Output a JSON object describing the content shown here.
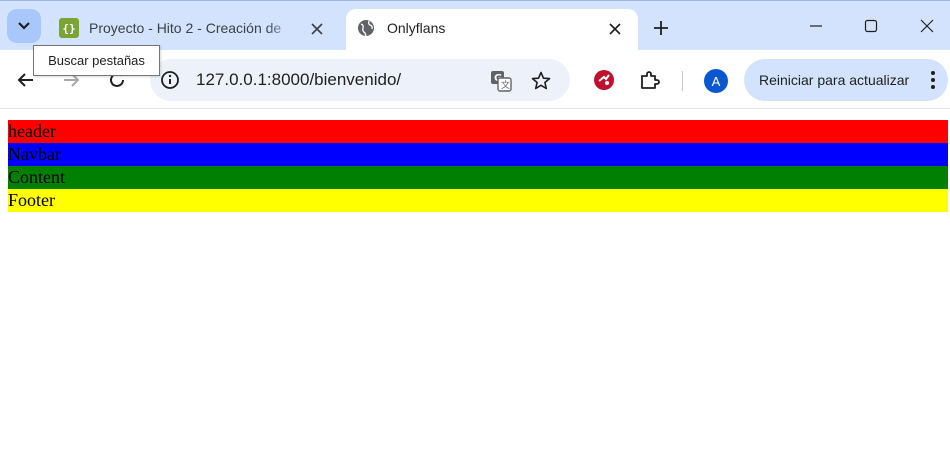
{
  "tabs": [
    {
      "title": "Proyecto - Hito 2 - Creación de",
      "active": false,
      "favicon": "pycharm-icon"
    },
    {
      "title": "Onlyflans",
      "active": true,
      "favicon": "globe-icon"
    }
  ],
  "tooltip": {
    "text": "Buscar pestañas"
  },
  "address_bar": {
    "url": "127.0.0.1:8000/bienvenido/"
  },
  "profile": {
    "initial": "A"
  },
  "update_button": {
    "label": "Reiniciar para actualizar"
  },
  "page": {
    "header": {
      "text": "header",
      "color": "#ff0000"
    },
    "navbar": {
      "text": "Navbar",
      "color": "#0000ff"
    },
    "content": {
      "text": "Content",
      "color": "#008000"
    },
    "footer": {
      "text": "Footer",
      "color": "#ffff00"
    }
  }
}
